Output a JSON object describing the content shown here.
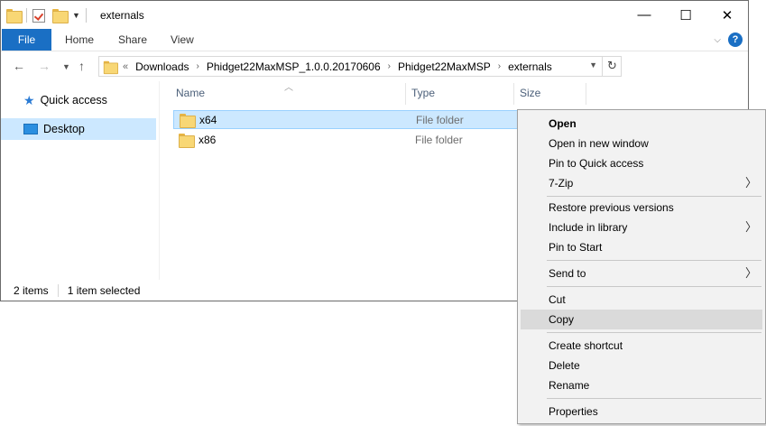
{
  "titlebar": {
    "title": "externals",
    "minimize": "—",
    "maximize": "☐",
    "close": "✕"
  },
  "ribbon": {
    "tabs": [
      "File",
      "Home",
      "Share",
      "View"
    ],
    "help": "?"
  },
  "address": {
    "prefix": "«",
    "crumbs": [
      "Downloads",
      "Phidget22MaxMSP_1.0.0.20170606",
      "Phidget22MaxMSP",
      "externals"
    ]
  },
  "navpane": {
    "items": [
      "Quick access",
      "Desktop"
    ]
  },
  "list": {
    "columns": [
      "Name",
      "Type",
      "Size"
    ],
    "rows": [
      {
        "name": "x64",
        "type": "File folder"
      },
      {
        "name": "x86",
        "type": "File folder"
      }
    ]
  },
  "status": {
    "count": "2 items",
    "selection": "1 item selected"
  },
  "context_menu": {
    "items": [
      "Open",
      "Open in new window",
      "Pin to Quick access",
      "7-Zip",
      "Restore previous versions",
      "Include in library",
      "Pin to Start",
      "Send to",
      "Cut",
      "Copy",
      "Create shortcut",
      "Delete",
      "Rename",
      "Properties"
    ]
  },
  "colors": {
    "accent": "#1a6fc4",
    "selection": "#cce8ff",
    "menu_hover": "#dadada"
  }
}
